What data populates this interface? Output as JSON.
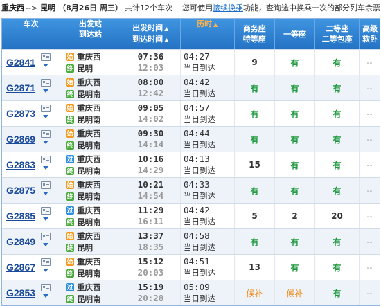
{
  "topbar": {
    "from": "重庆西",
    "arrow": "-->",
    "to": "昆明",
    "date": "（8月26日  周三）",
    "count": "共计12个车次",
    "notice_pre": "您可使用",
    "notice_link": "接续换乘",
    "notice_post": "功能，查询途中换乘一次的部分列车余票"
  },
  "header": {
    "train": "车次",
    "station_l1": "出发站",
    "station_l2": "到达站",
    "time_l1": "出发时间",
    "time_l2": "到达时间",
    "duration": "历时",
    "business_l1": "商务座",
    "business_l2": "特等座",
    "first": "一等座",
    "second_l1": "二等座",
    "second_l2": "二等包座",
    "soft_l1": "高级",
    "soft_l2": "软卧"
  },
  "rows": [
    {
      "train": "G2841",
      "from": "重庆西",
      "to": "昆明",
      "from_badge": "始",
      "to_badge": "终",
      "dep": "07:36",
      "arr": "12:03",
      "dur": "04:27",
      "day": "当日到达",
      "business": "9",
      "first": "有",
      "second": "有",
      "soft": "--"
    },
    {
      "train": "G2871",
      "from": "重庆西",
      "to": "昆明南",
      "from_badge": "始",
      "to_badge": "终",
      "dep": "08:00",
      "arr": "12:42",
      "dur": "04:42",
      "day": "当日到达",
      "business": "有",
      "first": "有",
      "second": "有",
      "soft": "--"
    },
    {
      "train": "G2873",
      "from": "重庆西",
      "to": "昆明南",
      "from_badge": "始",
      "to_badge": "终",
      "dep": "09:05",
      "arr": "14:02",
      "dur": "04:57",
      "day": "当日到达",
      "business": "有",
      "first": "有",
      "second": "有",
      "soft": "--"
    },
    {
      "train": "G2869",
      "from": "重庆西",
      "to": "昆明南",
      "from_badge": "始",
      "to_badge": "终",
      "dep": "09:30",
      "arr": "14:14",
      "dur": "04:44",
      "day": "当日到达",
      "business": "有",
      "first": "有",
      "second": "有",
      "soft": "--"
    },
    {
      "train": "G2883",
      "from": "重庆西",
      "to": "昆明南",
      "from_badge": "过",
      "to_badge": "终",
      "dep": "10:16",
      "arr": "14:29",
      "dur": "04:13",
      "day": "当日到达",
      "business": "15",
      "first": "有",
      "second": "有",
      "soft": "--"
    },
    {
      "train": "G2875",
      "from": "重庆西",
      "to": "昆明南",
      "from_badge": "始",
      "to_badge": "终",
      "dep": "10:21",
      "arr": "14:54",
      "dur": "04:33",
      "day": "当日到达",
      "business": "有",
      "first": "有",
      "second": "有",
      "soft": "--"
    },
    {
      "train": "G2885",
      "from": "重庆西",
      "to": "昆明南",
      "from_badge": "过",
      "to_badge": "终",
      "dep": "11:29",
      "arr": "16:11",
      "dur": "04:42",
      "day": "当日到达",
      "business": "5",
      "first": "2",
      "second": "20",
      "soft": "--"
    },
    {
      "train": "G2849",
      "from": "重庆西",
      "to": "昆明",
      "from_badge": "始",
      "to_badge": "终",
      "dep": "13:37",
      "arr": "18:35",
      "dur": "04:58",
      "day": "当日到达",
      "business": "有",
      "first": "有",
      "second": "有",
      "soft": "--"
    },
    {
      "train": "G2867",
      "from": "重庆西",
      "to": "昆明南",
      "from_badge": "始",
      "to_badge": "终",
      "dep": "15:12",
      "arr": "20:03",
      "dur": "04:51",
      "day": "当日到达",
      "business": "13",
      "first": "有",
      "second": "有",
      "soft": "--"
    },
    {
      "train": "G2853",
      "from": "重庆西",
      "to": "昆明南",
      "from_badge": "过",
      "to_badge": "终",
      "dep": "15:19",
      "arr": "20:28",
      "dur": "05:09",
      "day": "当日到达",
      "business": "候补",
      "first": "候补",
      "second": "有",
      "soft": "--"
    }
  ],
  "colors": {
    "header_bg": "#2f82d2",
    "available": "#1e9a3e",
    "waitlist": "#f08a1a",
    "badge_start": "#f29a1d",
    "badge_pass": "#2e8fe0",
    "badge_end": "#4aab3c"
  },
  "icons": {
    "passenger_card": "id-card-icon",
    "expand": "chevron-down-icon",
    "sort": "triangle-up-icon"
  }
}
